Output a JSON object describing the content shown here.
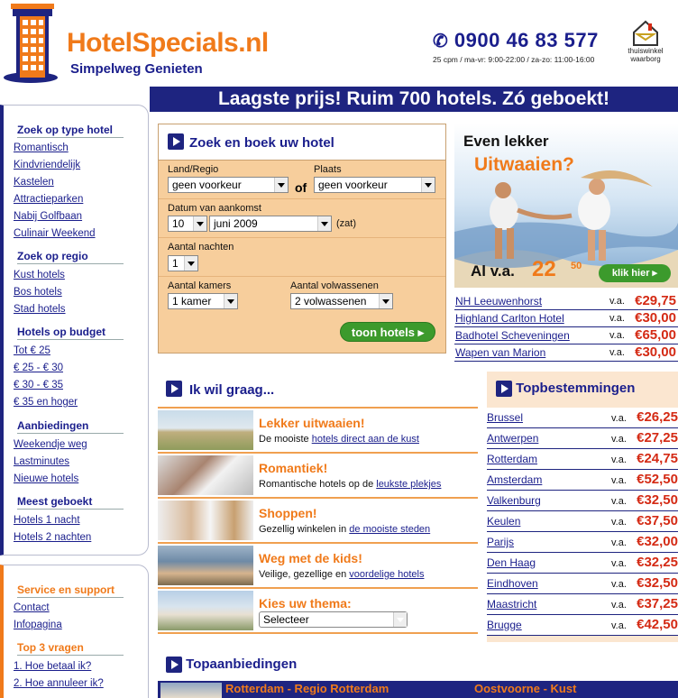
{
  "header": {
    "logo_text": "HotelSpecials.nl",
    "logo_sub": "Simpelweg Genieten",
    "phone": "0900 46 83 577",
    "phone_hours": "25 cpm / ma-vr: 9:00-22:00 / za-zo: 11:00-16:00",
    "badge_line1": "thuiswinkel",
    "badge_line2": "waarborg"
  },
  "banner": "Laagste prijs! Ruim 700 hotels. Zó geboekt!",
  "sidebar": {
    "sections": [
      {
        "title": "Zoek op type hotel",
        "items": [
          "Romantisch",
          "Kindvriendelijk",
          "Kastelen",
          "Attractieparken",
          "Nabij Golfbaan",
          "Culinair Weekend"
        ]
      },
      {
        "title": "Zoek op regio",
        "items": [
          "Kust hotels",
          "Bos hotels",
          "Stad hotels"
        ]
      },
      {
        "title": "Hotels op budget",
        "items": [
          "Tot € 25",
          "€ 25 - € 30",
          "€ 30 - € 35",
          "€ 35 en hoger"
        ]
      },
      {
        "title": "Aanbiedingen",
        "items": [
          "Weekendje weg",
          "Lastminutes",
          "Nieuwe hotels"
        ]
      },
      {
        "title": "Meest geboekt",
        "items": [
          "Hotels 1 nacht",
          "Hotels 2 nachten"
        ]
      }
    ],
    "service_title": "Service en support",
    "service_items": [
      "Contact",
      "Infopagina"
    ],
    "top3_title": "Top 3 vragen",
    "top3_items": [
      "1. Hoe betaal ik?",
      "2. Hoe annuleer ik?"
    ]
  },
  "search": {
    "title": "Zoek en boek uw hotel",
    "land_label": "Land/Regio",
    "land_value": "geen voorkeur",
    "of_label": "of",
    "plaats_label": "Plaats",
    "plaats_value": "geen voorkeur",
    "datum_label": "Datum van aankomst",
    "day_value": "10",
    "month_value": "juni 2009",
    "weekday": "(zat)",
    "nachten_label": "Aantal nachten",
    "nachten_value": "1",
    "kamers_label": "Aantal kamers",
    "kamers_value": "1 kamer",
    "volw_label": "Aantal volwassenen",
    "volw_value": "2 volwassenen",
    "button": "toon hotels"
  },
  "promo": {
    "line1": "Even lekker",
    "line2": "Uitwaaien?",
    "price_label": "Al v.a.",
    "price": "22",
    "cents": "50",
    "button": "klik hier"
  },
  "promo_hotels": [
    {
      "name": "NH Leeuwenhorst",
      "va": "v.a.",
      "price": "€29,75"
    },
    {
      "name": "Highland Carlton Hotel",
      "va": "v.a.",
      "price": "€30,00"
    },
    {
      "name": "Badhotel Scheveningen",
      "va": "v.a.",
      "price": "€65,00"
    },
    {
      "name": "Wapen van Marion",
      "va": "v.a.",
      "price": "€30,00"
    }
  ],
  "wil": {
    "title": "Ik wil graag...",
    "items": [
      {
        "head": "Lekker uitwaaien!",
        "pre": "De mooiste ",
        "link": "hotels direct aan de kust",
        "post": ""
      },
      {
        "head": "Romantiek!",
        "pre": "Romantische hotels op de ",
        "link": "leukste plekjes",
        "post": ""
      },
      {
        "head": "Shoppen!",
        "pre": "Gezellig winkelen in ",
        "link": "de mooiste steden",
        "post": ""
      },
      {
        "head": "Weg met de kids!",
        "pre": "Veilige, gezellige en ",
        "link": "voordelige hotels",
        "post": ""
      },
      {
        "head": "Kies uw thema:",
        "pre": "",
        "link": "",
        "post": ""
      }
    ],
    "thema_select": "Selecteer"
  },
  "topbestemmingen": {
    "title": "Topbestemmingen",
    "items": [
      {
        "name": "Brussel",
        "va": "v.a.",
        "price": "€26,25"
      },
      {
        "name": "Antwerpen",
        "va": "v.a.",
        "price": "€27,25"
      },
      {
        "name": "Rotterdam",
        "va": "v.a.",
        "price": "€24,75"
      },
      {
        "name": "Amsterdam",
        "va": "v.a.",
        "price": "€52,50"
      },
      {
        "name": "Valkenburg",
        "va": "v.a.",
        "price": "€32,50"
      },
      {
        "name": "Keulen",
        "va": "v.a.",
        "price": "€37,50"
      },
      {
        "name": "Parijs",
        "va": "v.a.",
        "price": "€32,00"
      },
      {
        "name": "Den Haag",
        "va": "v.a.",
        "price": "€32,25"
      },
      {
        "name": "Eindhoven",
        "va": "v.a.",
        "price": "€32,50"
      },
      {
        "name": "Maastricht",
        "va": "v.a.",
        "price": "€37,25"
      },
      {
        "name": "Brugge",
        "va": "v.a.",
        "price": "€42,50"
      }
    ]
  },
  "topaanbiedingen": {
    "title": "Topaanbiedingen",
    "left": "Rotterdam - Regio Rotterdam",
    "right": "Oostvoorne - Kust"
  }
}
